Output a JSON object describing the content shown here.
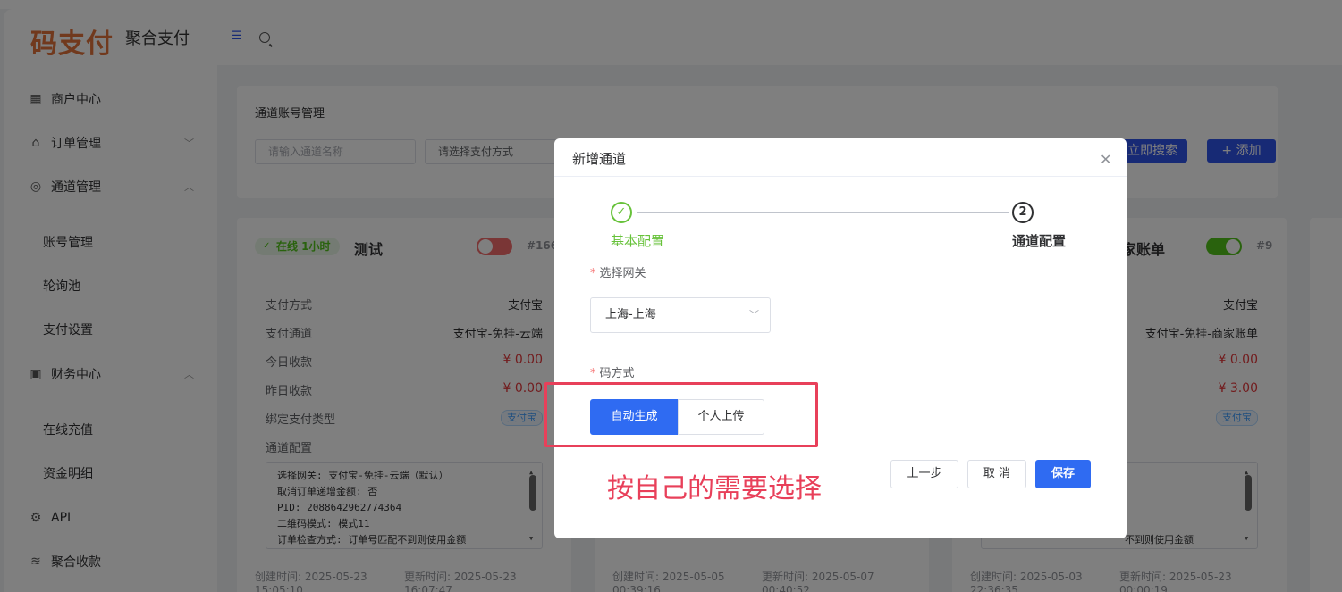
{
  "header": {
    "logo": "码支付",
    "subtitle": "聚合支付"
  },
  "sidebar": {
    "items": [
      {
        "label": "商户中心"
      },
      {
        "label": "订单管理"
      },
      {
        "label": "通道管理"
      },
      {
        "label": "账号管理"
      },
      {
        "label": "轮询池"
      },
      {
        "label": "支付设置"
      },
      {
        "label": "财务中心"
      },
      {
        "label": "在线充值"
      },
      {
        "label": "资金明细"
      },
      {
        "label": "API"
      },
      {
        "label": "聚合收款"
      }
    ]
  },
  "main": {
    "title": "通道账号管理",
    "filters": {
      "name_placeholder": "请输入通道名称",
      "pay_placeholder": "请选择支付方式"
    },
    "search_label": "立即搜索",
    "add_label": "+ 添加"
  },
  "cards": [
    {
      "status": "在线 1小时",
      "name": "测试",
      "id": "#166",
      "enabled": false,
      "rows": {
        "pay_method_k": "支付方式",
        "pay_method_v": "支付宝",
        "channel_k": "支付通道",
        "channel_v": "支付宝-免挂-云端",
        "today_k": "今日收款",
        "today_v": "¥ 0.00",
        "yesterday_k": "昨日收款",
        "yesterday_v": "¥ 0.00",
        "bind_k": "绑定支付类型",
        "bind_v": "支付宝",
        "conf_k": "通道配置"
      },
      "config": [
        "选择网关: 支付宝-免挂-云端（默认）",
        "取消订单递增金额: 否",
        "PID: 2088642962774364",
        "二维码模式: 模式11",
        "订单检查方式: 订单号匹配不到则使用金额"
      ],
      "created": "创建时间: 2025-05-23",
      "created_time": "15:05:10",
      "updated": "更新时间: 2025-05-23",
      "updated_time": "16:07:47"
    },
    {
      "created": "创建时间: 2025-05-05",
      "created_time": "00:39:16",
      "updated": "更新时间: 2025-05-07",
      "updated_time": "00:40:52"
    },
    {
      "name": "家账单",
      "id": "#9",
      "enabled": true,
      "rows": {
        "pay_method_v": "支付宝",
        "channel_v": "支付宝-免挂-商家账单",
        "today_v": "¥ 0.00",
        "yesterday_v": "¥ 3.00",
        "bind_v": "支付宝"
      },
      "config_last": "不到则使用金额",
      "created": "创建时间: 2025-05-03",
      "created_time": "22:36:35",
      "updated": "更新时间: 2025-05-23",
      "updated_time": "00:00:19"
    }
  ],
  "dialog": {
    "title": "新增通道",
    "steps": [
      {
        "label": "基本配置",
        "done": true
      },
      {
        "num": "2",
        "label": "通道配置"
      }
    ],
    "gateway_label": "选择网关",
    "gateway_value": "上海-上海",
    "mode_label": "码方式",
    "mode_options": [
      "自动生成",
      "个人上传"
    ],
    "mode_selected": "自动生成",
    "annotation": "按自己的需要选择",
    "buttons": {
      "prev": "上一步",
      "cancel": "取 消",
      "save": "保存"
    }
  },
  "colors": {
    "primary": "#2f6bf2",
    "success": "#67c23a",
    "danger": "#e8405a",
    "logo": "#e2733b"
  }
}
